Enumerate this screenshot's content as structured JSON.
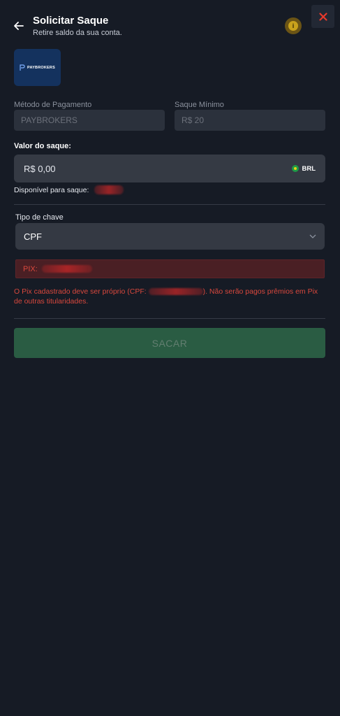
{
  "header": {
    "title": "Solicitar Saque",
    "subtitle": "Retire saldo da sua conta.",
    "info_icon_glyph": "i"
  },
  "logo": {
    "text": "PAYBROKERS"
  },
  "payment_method": {
    "label": "Método de Pagamento",
    "value": "PAYBROKERS"
  },
  "minimum": {
    "label": "Saque Mínimo",
    "value": "R$ 20"
  },
  "amount": {
    "label": "Valor do saque:",
    "value": "R$ 0,00",
    "currency": "BRL"
  },
  "available": {
    "label": "Disponível para saque:"
  },
  "key_type": {
    "label": "Tipo de chave",
    "selected": "CPF"
  },
  "pix": {
    "label": "PIX:"
  },
  "warning": {
    "before": "O Pix cadastrado deve ser próprio (CPF: ",
    "after": "). Não serão pagos prêmios em Pix de outras titularidades."
  },
  "submit": {
    "label": "SACAR"
  },
  "colors": {
    "background": "#161b25",
    "error": "#d9483d",
    "submit_disabled": "#2a5c43",
    "close_icon": "#e8392b"
  }
}
